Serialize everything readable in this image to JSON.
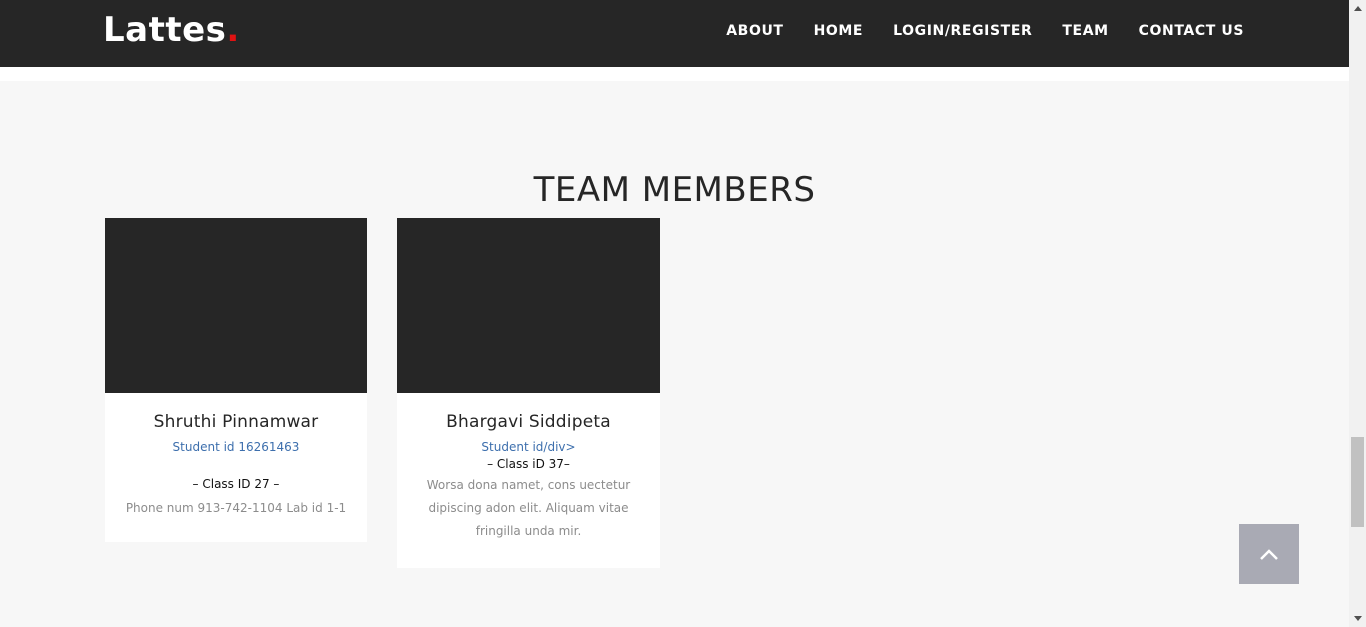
{
  "brand": {
    "name": "Lattes",
    "dot": "."
  },
  "nav": {
    "items": [
      {
        "label": "ABOUT"
      },
      {
        "label": "HOME"
      },
      {
        "label": "LOGIN/REGISTER"
      },
      {
        "label": "TEAM"
      },
      {
        "label": "CONTACT US"
      }
    ]
  },
  "section": {
    "title": "TEAM MEMBERS"
  },
  "members": [
    {
      "name": "Shruthi Pinnamwar",
      "student_id": "Student id 16261463",
      "class_id": "– Class ID 27 –",
      "description": "Phone num 913-742-1104 Lab id 1-1"
    },
    {
      "name": "Bhargavi Siddipeta",
      "student_id": "Student id/div>",
      "class_id": "– Class iD 37–",
      "description": "Worsa dona namet, cons uectetur dipiscing adon elit. Aliquam vitae fringilla unda mir."
    }
  ],
  "back_to_top": {
    "icon": "chevron-up-icon"
  },
  "colors": {
    "navbar": "#262626",
    "accent_dot": "#e01212",
    "link_blue": "#3d6fad",
    "page_bg": "#f7f7f7",
    "back_to_top_bg": "#a9aab4"
  }
}
